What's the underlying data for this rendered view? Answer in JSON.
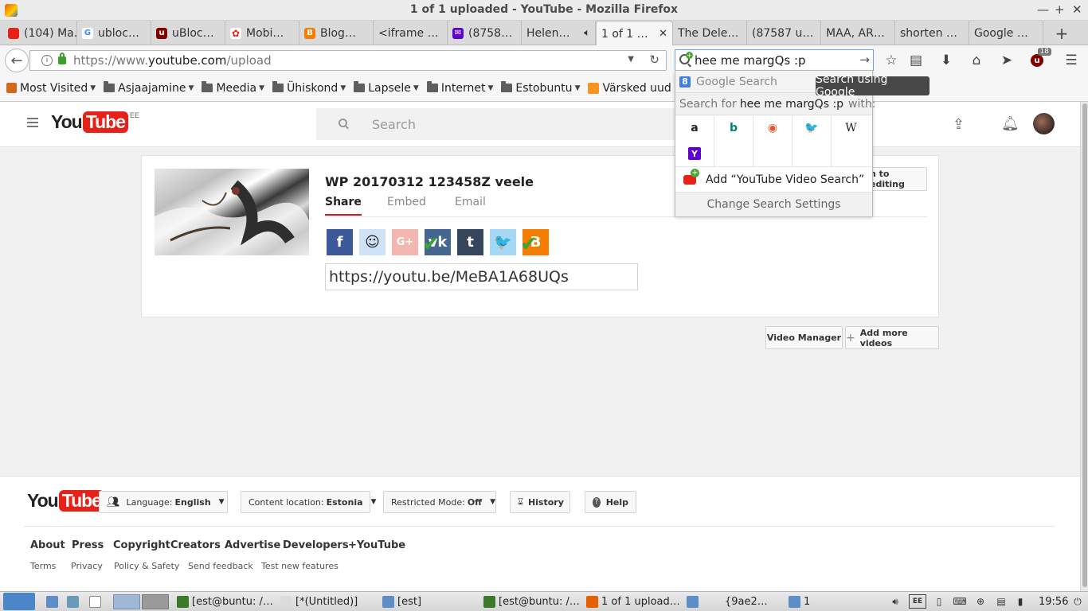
{
  "window": {
    "title": "1 of 1 uploaded - YouTube - Mozilla Firefox"
  },
  "tabs": [
    {
      "label": "(104) Ma…",
      "icon": "youtube-icon"
    },
    {
      "label": "ubloc…",
      "icon": "google-icon"
    },
    {
      "label": "uBloc…",
      "icon": "ublock-icon"
    },
    {
      "label": "Mobi…",
      "icon": "huawei-icon"
    },
    {
      "label": "Blog…",
      "icon": "blogger-icon"
    },
    {
      "label": "<iframe …",
      "icon": "none"
    },
    {
      "label": "(8758…",
      "icon": "mail-icon"
    },
    {
      "label": "Helen…",
      "icon": "none"
    },
    {
      "label": "1 of 1 …",
      "icon": "none",
      "active": true
    },
    {
      "label": "The Dele…",
      "icon": "none"
    },
    {
      "label": "(87587 u…",
      "icon": "none"
    },
    {
      "label": "MAA, AR…",
      "icon": "none"
    },
    {
      "label": "shorten …",
      "icon": "none"
    },
    {
      "label": "Google …",
      "icon": "none"
    }
  ],
  "navbar": {
    "url_prefix": "https://www.",
    "url_host": "youtube.com",
    "url_path": "/upload",
    "search_value": "hee me margQs :p",
    "ublock_badge": "18"
  },
  "bookmarks": [
    {
      "label": "Most Visited",
      "dropdown": true,
      "icon": "gear"
    },
    {
      "label": "Asjaajamine",
      "dropdown": true,
      "icon": "folder"
    },
    {
      "label": "Meedia",
      "dropdown": true,
      "icon": "folder"
    },
    {
      "label": "Ühiskond",
      "dropdown": true,
      "icon": "folder"
    },
    {
      "label": "Lapsele",
      "dropdown": true,
      "icon": "folder"
    },
    {
      "label": "Internet",
      "dropdown": true,
      "icon": "folder"
    },
    {
      "label": "Estobuntu",
      "dropdown": true,
      "icon": "folder"
    },
    {
      "label": "Värsked uud",
      "dropdown": false,
      "icon": "rss"
    }
  ],
  "yt_header": {
    "logo_you": "You",
    "logo_tube": "Tube",
    "region": "EE",
    "search_placeholder": "Search"
  },
  "upload": {
    "video_title": "WP 20170312 123458Z veele",
    "tabs": [
      "Share",
      "Embed",
      "Email"
    ],
    "share_url": "https://youtu.be/MeBA1A68UQs",
    "back_to_editing": "n to editing",
    "social": [
      {
        "name": "facebook",
        "glyph": "f",
        "color": "#3b5998"
      },
      {
        "name": "reddit",
        "glyph": "☺",
        "color": "#cee3f8"
      },
      {
        "name": "google-plus",
        "glyph": "G+",
        "color": "#f2b7b1"
      },
      {
        "name": "vk",
        "glyph": "vk",
        "color": "#45668e"
      },
      {
        "name": "tumblr",
        "glyph": "t",
        "color": "#35465c"
      },
      {
        "name": "twitter",
        "glyph": "🐦",
        "color": "#a4d8f5"
      },
      {
        "name": "blogger",
        "glyph": "B",
        "color": "#f57d00"
      }
    ]
  },
  "actions": {
    "video_manager": "Video Manager",
    "add_more": "Add more videos"
  },
  "search_popup": {
    "engine": "Google Search",
    "search_for_prefix": "Search for",
    "query": "hee me margQs :p",
    "search_for_suffix": "with:",
    "engines_row1": [
      {
        "name": "amazon",
        "glyph": "a",
        "color": "#222"
      },
      {
        "name": "bing",
        "glyph": "b",
        "color": "#008373"
      },
      {
        "name": "duckduckgo",
        "glyph": "◉",
        "color": "#de5833"
      },
      {
        "name": "twitter",
        "glyph": "🐦",
        "color": "#1da1f2"
      },
      {
        "name": "wikipedia",
        "glyph": "W",
        "color": "#222"
      }
    ],
    "engines_row2": [
      {
        "name": "yahoo",
        "glyph": "Y",
        "color": "#5f01d1"
      }
    ],
    "add_engine": "Add “YouTube Video Search”",
    "change_settings": "Change Search Settings",
    "tooltip": "Search using Google"
  },
  "footer": {
    "logo_you": "You",
    "logo_tube": "Tube",
    "language_label": "Language:",
    "language_value": "English",
    "location_label": "Content location:",
    "location_value": "Estonia",
    "restricted_label": "Restricted Mode:",
    "restricted_value": "Off",
    "history": "History",
    "help": "Help",
    "links": [
      "About",
      "Press",
      "Copyright",
      "Creators",
      "Advertise",
      "Developers",
      "+YouTube"
    ],
    "links2": [
      "Terms",
      "Privacy",
      "Policy & Safety",
      "Send feedback",
      "Test new features"
    ]
  },
  "taskbar": {
    "items": [
      "[est@buntu: /…",
      "[*(Untitled)]",
      "[est]",
      "[est@buntu: /…",
      "1 of 1 upload…",
      "",
      "{9ae2…",
      "1"
    ],
    "lang": "EE",
    "clock": "19:56"
  },
  "colors": {
    "youtube_red": "#e62117",
    "accent_blue": "#6aa3e6",
    "check_green": "#3aa53a"
  }
}
